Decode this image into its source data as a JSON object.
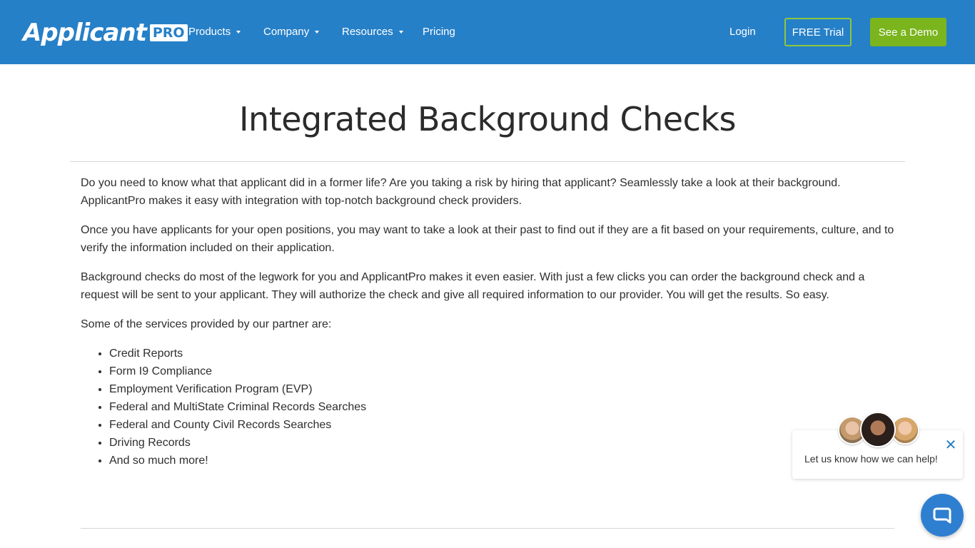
{
  "brand": {
    "word": "Applicant",
    "badge": "PRO"
  },
  "nav": {
    "items": [
      {
        "label": "Products",
        "dropdown": true
      },
      {
        "label": "Company",
        "dropdown": true
      },
      {
        "label": "Resources",
        "dropdown": true
      },
      {
        "label": "Pricing",
        "dropdown": false
      }
    ],
    "login": "Login",
    "free_trial": "FREE Trial",
    "demo": "See a Demo"
  },
  "page": {
    "title": "Integrated Background Checks",
    "paragraphs": [
      "Do you need to know what that applicant did in a former life? Are you taking a risk by hiring that applicant? Seamlessly take a look at their background. ApplicantPro makes it easy with integration with top-notch background check providers.",
      "Once you have applicants for your open positions, you may want to take a look at their past to find out if they are a fit based on your requirements, culture, and to verify the information included on their application.",
      "Background checks do most of the legwork for you and ApplicantPro makes it even easier. With just a few clicks you can order the background check and a request will be sent to your applicant. They will authorize the check and give all required information to our provider. You will get the results. So easy.",
      "Some of the services provided by our partner are:"
    ],
    "services": [
      "Credit Reports",
      "Form I9 Compliance",
      "Employment Verification Program (EVP)",
      "Federal and MultiState Criminal Records Searches",
      "Federal and County Civil Records Searches",
      "Driving Records",
      "And so much more!"
    ]
  },
  "chat": {
    "message": "Let us know how we can help!",
    "close_icon": "close-icon",
    "launcher_icon": "chat-bubble-icon"
  },
  "colors": {
    "header": "#2680c8",
    "accent_green": "#7ab51d",
    "chat_blue": "#2f7fd1"
  }
}
